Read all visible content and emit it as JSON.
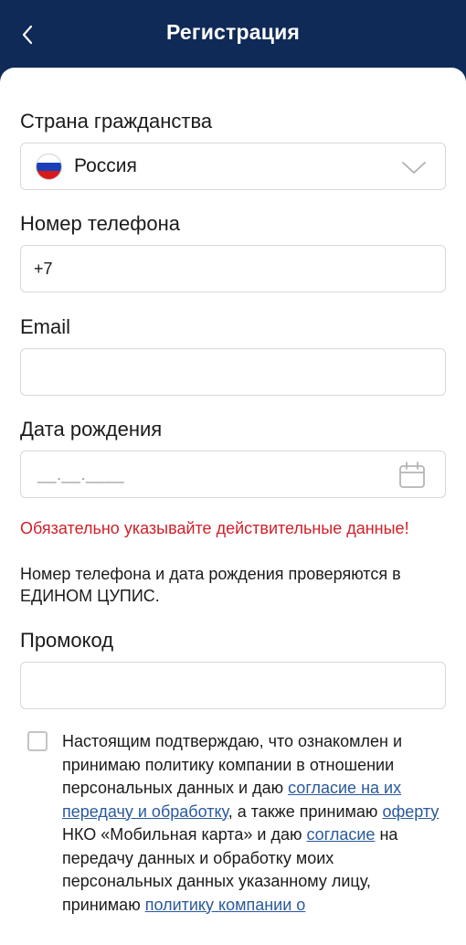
{
  "header": {
    "title": "Регистрация",
    "back_icon": "chevron-left-icon"
  },
  "colors": {
    "header_bg": "#0f2a57",
    "warning": "#d0202a",
    "link": "#2a5a9c"
  },
  "form": {
    "citizenship": {
      "label": "Страна гражданства",
      "value": "Россия",
      "flag": "russia-flag-icon"
    },
    "phone": {
      "label": "Номер телефона",
      "value": "+7"
    },
    "email": {
      "label": "Email",
      "value": ""
    },
    "birthdate": {
      "label": "Дата рождения",
      "mask": "__.__.____"
    },
    "promo": {
      "label": "Промокод",
      "value": ""
    }
  },
  "notice": {
    "warning": "Обязательно указывайте действительные данные!",
    "info": "Номер телефона и дата рождения проверяются в ЕДИНОМ ЦУПИС."
  },
  "consent": {
    "checked": false,
    "t1": "Настоящим подтверждаю, что ознакомлен и принимаю политику компании в отношении персональных данных и даю ",
    "link1": "согласие на их передачу и обработку",
    "t2": ", а также принимаю ",
    "link2": "оферту",
    "t3": " НКО «Мобильная карта» и даю ",
    "link3": "согласие",
    "t4": " на передачу данных и обработку моих персональных данных указанному лицу, принимаю ",
    "link4": "политику компании о"
  }
}
